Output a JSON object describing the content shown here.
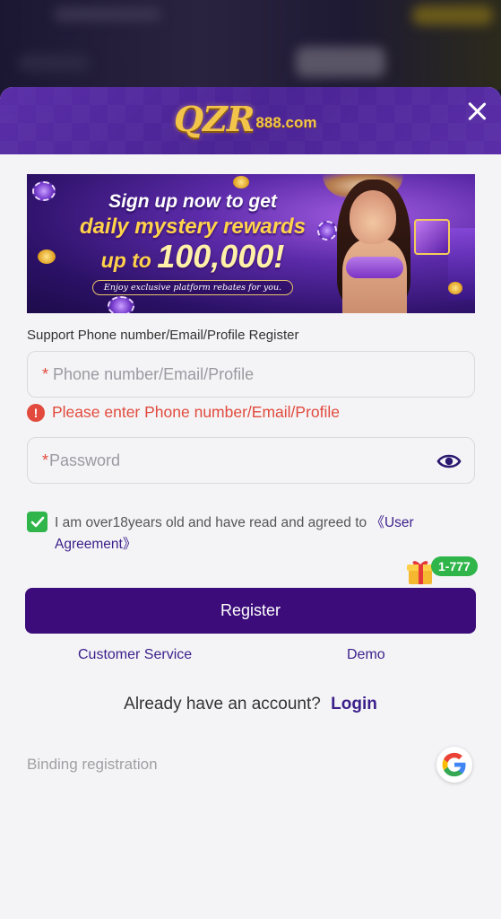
{
  "header": {
    "logo_main": "QZR",
    "logo_sub": "888.com"
  },
  "banner": {
    "line1": "Sign up now to get",
    "line2": "daily mystery rewards",
    "line3_prefix": "up to",
    "line3_amount": "100,000!",
    "subtitle": "Enjoy exclusive platform rebates for you."
  },
  "form": {
    "support_label": "Support Phone number/Email/Profile Register",
    "phone_placeholder": "Phone number/Email/Profile",
    "phone_error": "Please enter Phone number/Email/Profile",
    "password_placeholder": "Password",
    "required_mark": "*",
    "agreement_text": "I am over18years old and have read and agreed to",
    "agreement_link": "《User Agreement》",
    "promo_badge": "1-777",
    "register_label": "Register"
  },
  "links": {
    "customer_service": "Customer Service",
    "demo": "Demo",
    "already_text": "Already have an account?",
    "login": "Login",
    "binding": "Binding registration"
  },
  "colors": {
    "primary": "#3b0c7a",
    "header": "#4a2394",
    "error": "#e24a3d",
    "success": "#2fb54a",
    "link": "#3b1e8a"
  },
  "icons": {
    "close": "close-icon",
    "eye": "eye-icon",
    "error": "error-icon",
    "check": "check-icon",
    "gift": "gift-icon",
    "google": "google-icon"
  }
}
